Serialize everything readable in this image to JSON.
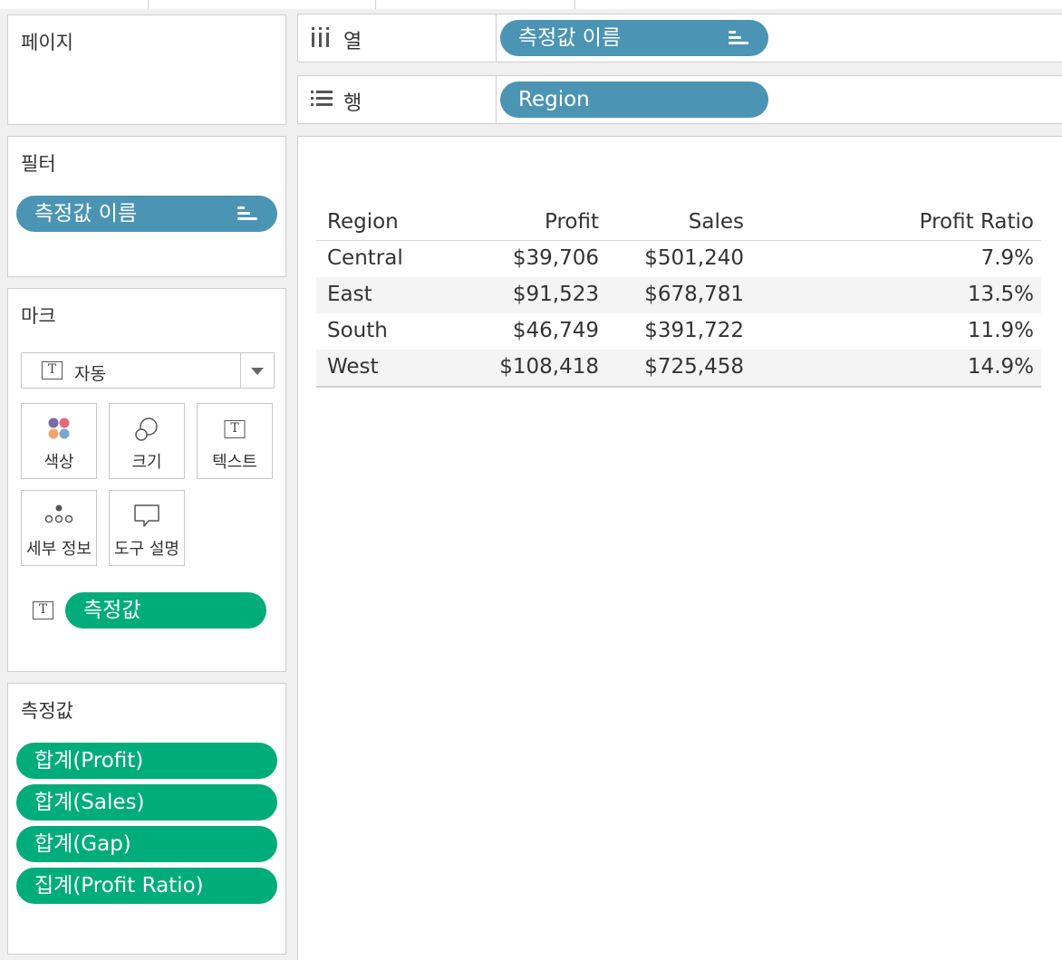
{
  "pages": {
    "title": "페이지"
  },
  "filters": {
    "title": "필터",
    "pill": "측정값 이름"
  },
  "marks": {
    "title": "마크",
    "mark_type": "자동",
    "cards": [
      {
        "label": "색상",
        "icon": "color-dots-icon"
      },
      {
        "label": "크기",
        "icon": "size-circles-icon"
      },
      {
        "label": "텍스트",
        "icon": "text-box-icon"
      },
      {
        "label": "세부 정보",
        "icon": "detail-dots-icon"
      },
      {
        "label": "도구 설명",
        "icon": "tooltip-bubble-icon"
      }
    ],
    "text_pill": "측정값"
  },
  "measure_values": {
    "title": "측정값",
    "items": [
      "합계(Profit)",
      "합계(Sales)",
      "합계(Gap)",
      "집계(Profit Ratio)"
    ]
  },
  "shelves": {
    "columns": {
      "label": "열",
      "pill": "측정값 이름",
      "icon": "columns-icon"
    },
    "rows": {
      "label": "행",
      "pill": "Region",
      "icon": "rows-icon"
    }
  },
  "table": {
    "headers": [
      "Region",
      "Profit",
      "Sales",
      "Profit Ratio"
    ],
    "rows": [
      [
        "Central",
        "$39,706",
        "$501,240",
        "7.9%"
      ],
      [
        "East",
        "$91,523",
        "$678,781",
        "13.5%"
      ],
      [
        "South",
        "$46,749",
        "$391,722",
        "11.9%"
      ],
      [
        "West",
        "$108,418",
        "$725,458",
        "14.9%"
      ]
    ]
  },
  "colors": {
    "dimension_pill": "#4b94b4",
    "measure_pill": "#00ad7a"
  }
}
